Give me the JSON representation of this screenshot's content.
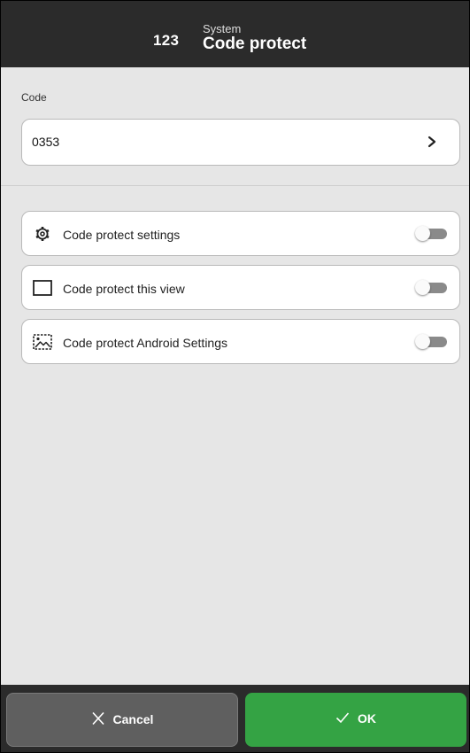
{
  "header": {
    "number": "123",
    "section": "System",
    "title": "Code protect"
  },
  "code": {
    "label": "Code",
    "value": "0353",
    "chevron_icon": "chevron-right-icon"
  },
  "settings": [
    {
      "label": "Code protect settings",
      "icon": "gear-icon",
      "enabled": false
    },
    {
      "label": "Code protect this view",
      "icon": "rectangle-icon",
      "enabled": false
    },
    {
      "label": "Code protect Android Settings",
      "icon": "picture-icon",
      "enabled": false
    }
  ],
  "footer": {
    "cancel_label": "Cancel",
    "cancel_icon": "close-icon",
    "ok_label": "OK",
    "ok_icon": "checkmark-icon"
  },
  "colors": {
    "header_bg": "#2b2b2b",
    "page_bg": "#e6e6e6",
    "ok_green": "#34a344",
    "cancel_gray": "#5f5f5f",
    "toggle_off": "#8a8a8a"
  }
}
